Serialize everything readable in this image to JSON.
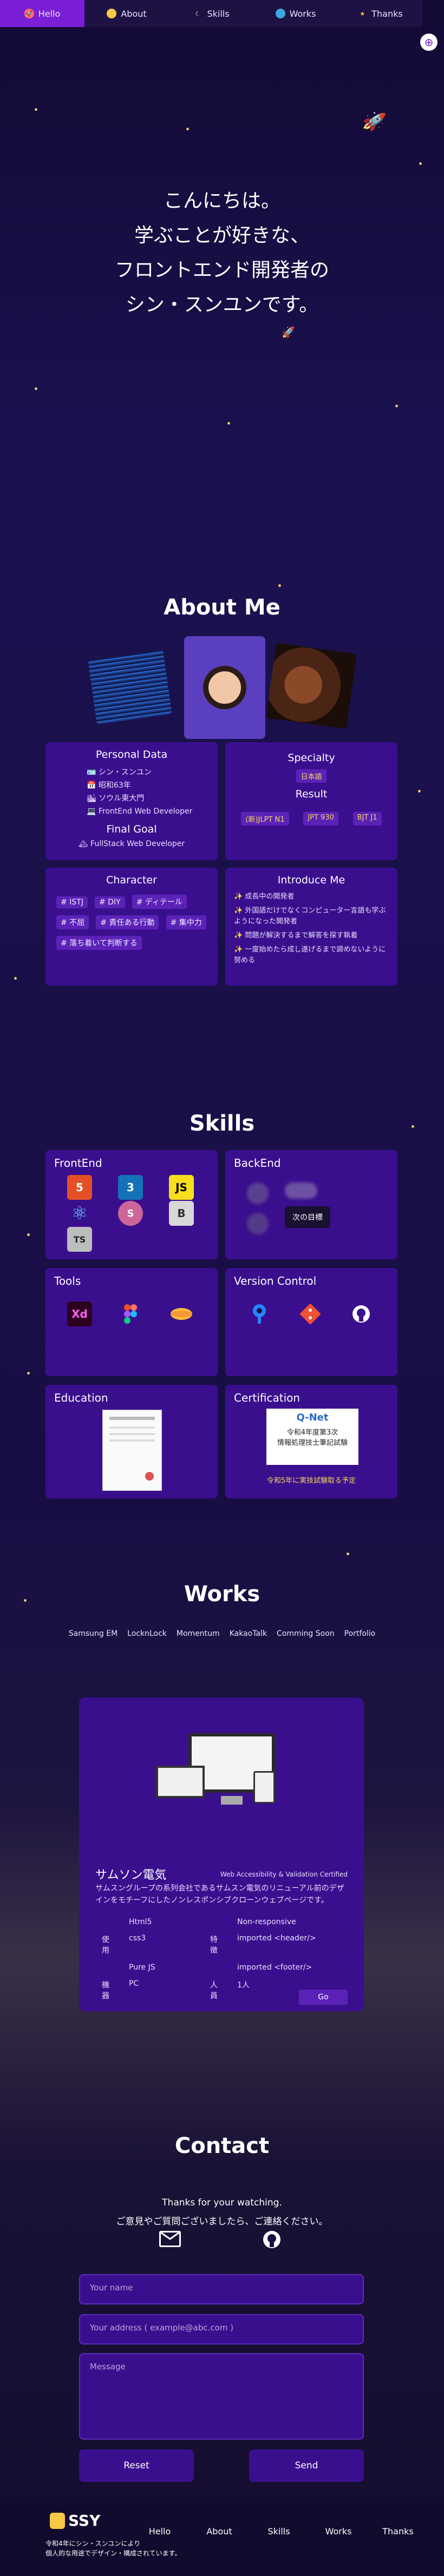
{
  "nav": {
    "items": [
      {
        "label": "Hello",
        "icon": "rocket-icon",
        "active": true
      },
      {
        "label": "About",
        "icon": "sun-icon"
      },
      {
        "label": "Skills",
        "icon": "moon-icon"
      },
      {
        "label": "Works",
        "icon": "earth-icon"
      },
      {
        "label": "Thanks",
        "icon": "star-icon"
      }
    ],
    "lang_icon": "globe-icon"
  },
  "hero": {
    "lines": [
      "こんにちは。",
      "学ぶことが好きな、",
      "フロントエンド開発者の",
      "シン・スンユンです。"
    ]
  },
  "about": {
    "title": "About Me",
    "personal": {
      "heading": "Personal Data",
      "items": [
        "シン・スンユン",
        "昭和63年",
        "ソウル東大門",
        "FrontEnd Web Developer"
      ]
    },
    "goal": {
      "heading": "Final Goal",
      "item": "FullStack Web Developer"
    },
    "specialty": {
      "heading": "Specialty",
      "tag": "日本語",
      "result_heading": "Result",
      "results": [
        "(新)JLPT N1",
        "JPT 930",
        "BJT J1"
      ]
    },
    "character": {
      "heading": "Character",
      "tags": [
        "# ISTJ",
        "# DIY",
        "# ディテール",
        "# 不屈",
        "# 責任ある行動",
        "# 集中力",
        "# 落ち着いて判断する"
      ]
    },
    "introduce": {
      "heading": "Introduce Me",
      "items": [
        "成長中の開発者",
        "外国語だけでなくコンピューター言語も学ぶようになった開発者",
        "問題が解決するまで解答を探す執着",
        "一度始めたら成し遂げるまで諦めないように努める"
      ]
    }
  },
  "skills": {
    "title": "Skills",
    "frontend": {
      "heading": "FrontEnd",
      "icons": [
        "html5-icon",
        "css3-icon",
        "javascript-icon",
        "react-icon",
        "sass-icon",
        "bootstrap-icon",
        "typescript-icon"
      ],
      "labels": {
        "html": "5",
        "css": "3",
        "js": "JS",
        "bootstrap": "B",
        "ts": "TS"
      }
    },
    "backend": {
      "heading": "BackEnd",
      "next": "次の目標"
    },
    "tools": {
      "heading": "Tools",
      "xd": "Xd"
    },
    "vcs": {
      "heading": "Version Control"
    },
    "education": {
      "heading": "Education"
    },
    "certification": {
      "heading": "Certification",
      "badge_lines": [
        "Q-Net",
        "令和4年度第3次",
        "情報処理技士筆記試験"
      ],
      "note": "令和5年に実技試験取る予定"
    }
  },
  "works": {
    "title": "Works",
    "tabs": [
      "Samsung EM",
      "LocknLock",
      "Momentum",
      "KakaoTalk",
      "Comming Soon",
      "Portfolio"
    ],
    "card": {
      "name": "サムソン電気",
      "certified": "Web Accessibility & Validation Certified",
      "desc": "サムスングループの系列会社であるサムスン電気のリニューアル前のデザインをモチーフにしたノンレスポンシブクローンウェブページです。",
      "rows": [
        [
          "",
          "Html5",
          "",
          "Non-responsive"
        ],
        [
          "使用",
          "css3",
          "特徴",
          "imported <header/>"
        ],
        [
          "",
          "Pure JS",
          "",
          "imported <footer/>"
        ],
        [
          "機器",
          "PC",
          "人員",
          "1人"
        ]
      ],
      "go": "Go"
    }
  },
  "contact": {
    "title": "Contact",
    "line1": "Thanks for your watching.",
    "line2": "ご意見やご質問ございましたら、ご連絡ください。",
    "name_placeholder": "Your name",
    "email_placeholder": "Your address ( example@abc.com )",
    "message_placeholder": "Message",
    "reset": "Reset",
    "send": "Send"
  },
  "footer": {
    "logo": "SSY",
    "copy1": "令和4年にシン・スンユンにより",
    "copy2": "個人的な用途でデザイン・構成されています。",
    "nav": [
      "Hello",
      "About",
      "Skills",
      "Works",
      "Thanks"
    ]
  }
}
